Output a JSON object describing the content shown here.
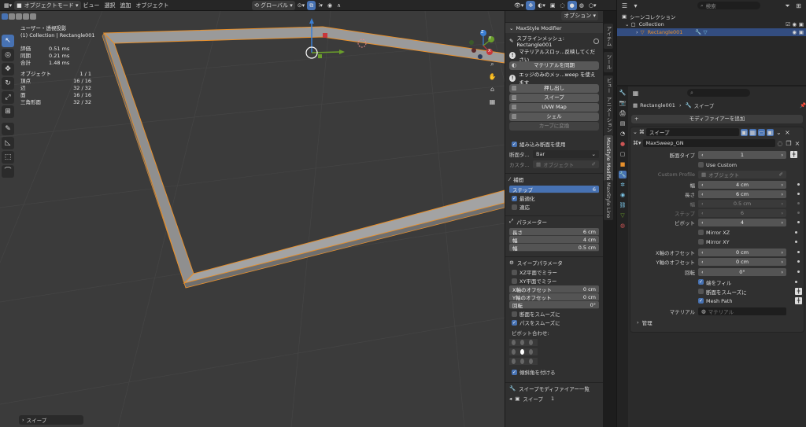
{
  "toolbar": {
    "mode": "オブジェクトモード",
    "menus": [
      "ビュー",
      "選択",
      "追加",
      "オブジェクト"
    ],
    "transform_orientation": "グローバル",
    "options_label": "オプション"
  },
  "viewport": {
    "view_name": "ユーザー・透視投影",
    "collection_info": "(1) Collection | Rectangle001",
    "timing": [
      {
        "label": "評価",
        "value": "0.51 ms"
      },
      {
        "label": "同期",
        "value": "0.21 ms"
      },
      {
        "label": "合計",
        "value": "1.48 ms"
      }
    ],
    "stats": [
      {
        "label": "オブジェクト",
        "value": "1 / 1"
      },
      {
        "label": "頂点",
        "value": "16 / 16"
      },
      {
        "label": "辺",
        "value": "32 / 32"
      },
      {
        "label": "面",
        "value": "16 / 16"
      },
      {
        "label": "三角形面",
        "value": "32 / 32"
      }
    ],
    "last_operation": "スイープ",
    "gizmo_axes": [
      "Z",
      "Y",
      "X"
    ]
  },
  "npanel": {
    "title": "MaxStyle Modifier",
    "spline_mesh": "スプラインメッシュ: Rectangle001",
    "material_msg": "マテリアルスロッ...反映してください",
    "sync_material_btn": "マテリアルを同期",
    "edge_msg": "エッジのみのメッ...weep を使えます",
    "buttons": [
      "押し出し",
      "スイープ",
      "UVW Map",
      "シェル"
    ],
    "curve_convert_btn": "カーブに変換",
    "builtin_section": "組み込み断面を使用",
    "section_type_label": "断面タ...",
    "section_type_value": "Bar",
    "custom_label": "カスタ...",
    "custom_placeholder": "オブジェクト",
    "interp_title": "補間",
    "steps_label": "ステップ",
    "steps_value": "6",
    "optimize_label": "最適化",
    "adaptive_label": "適応",
    "params_title": "パラメーター",
    "params": [
      {
        "label": "長さ",
        "value": "6 cm"
      },
      {
        "label": "幅",
        "value": "4 cm"
      },
      {
        "label": "幅",
        "value": "0.5 cm"
      }
    ],
    "sweep_params_title": "スイープパラメータ",
    "mirror_xz": "XZ平面でミラー",
    "mirror_xy": "XY平面でミラー",
    "offset_fields": [
      {
        "label": "X軸のオフセット",
        "value": "0 cm"
      },
      {
        "label": "Y軸のオフセット",
        "value": "0 cm"
      },
      {
        "label": "回転",
        "value": "0°"
      }
    ],
    "smooth_section": "断面をスムーズに",
    "smooth_path": "パスをスムーズに",
    "pivot_align_label": "ピボット合わせ:",
    "bevel_corners": "傾斜角を付ける",
    "sweep_modifier_list_title": "スイープモディファイアー一覧",
    "sweep_list_item_label": "スイープ",
    "sweep_list_item_value": "1"
  },
  "vertical_tabs": [
    "アイテム",
    "ツール",
    "ビュー",
    "アニメーション",
    "MaxStyle Modifier",
    "MaxStyle Line"
  ],
  "outliner": {
    "search_placeholder": "検索",
    "scene_collection": "シーンコレクション",
    "collection": "Collection",
    "object": "Rectangle001"
  },
  "properties": {
    "object_name": "Rectangle001",
    "modifier_name": "スイープ",
    "add_modifier_btn": "モディファイアーを追加",
    "modifier_title": "スイープ",
    "node_group": "MaxSweep_GN",
    "section_type_label": "断面タイプ",
    "section_type_value": "1",
    "use_custom": "Use Custom",
    "custom_profile_label": "Custom Profile",
    "custom_profile_placeholder": "オブジェクト",
    "width_label": "幅",
    "width_value": "4 cm",
    "length_label": "長さ",
    "length_value": "6 cm",
    "width2_label": "幅",
    "width2_value": "0.5 cm",
    "step_label": "ステップ",
    "step_value": "6",
    "pivot_label": "ピボット",
    "pivot_value": "4",
    "mirror_xz": "Mirror XZ",
    "mirror_xy": "Mirror XY",
    "x_offset_label": "X軸のオフセット",
    "x_offset_value": "0 cm",
    "y_offset_label": "Y軸のオフセット",
    "y_offset_value": "0 cm",
    "rotation_label": "回転",
    "rotation_value": "0°",
    "fill_ends": "端をフィル",
    "smooth_section": "断面をスムーズに",
    "mesh_path": "Mesh Path",
    "material_label": "マテリアル",
    "material_placeholder": "マテリアル",
    "manage_label": "管理"
  },
  "colors": {
    "accent": "#4772b3",
    "selection_outline": "#e8902c",
    "grid_floor": "#3b3b3b",
    "axis_x": "#c8373a",
    "axis_y": "#6a9e2b",
    "axis_z": "#3b7fd4"
  }
}
